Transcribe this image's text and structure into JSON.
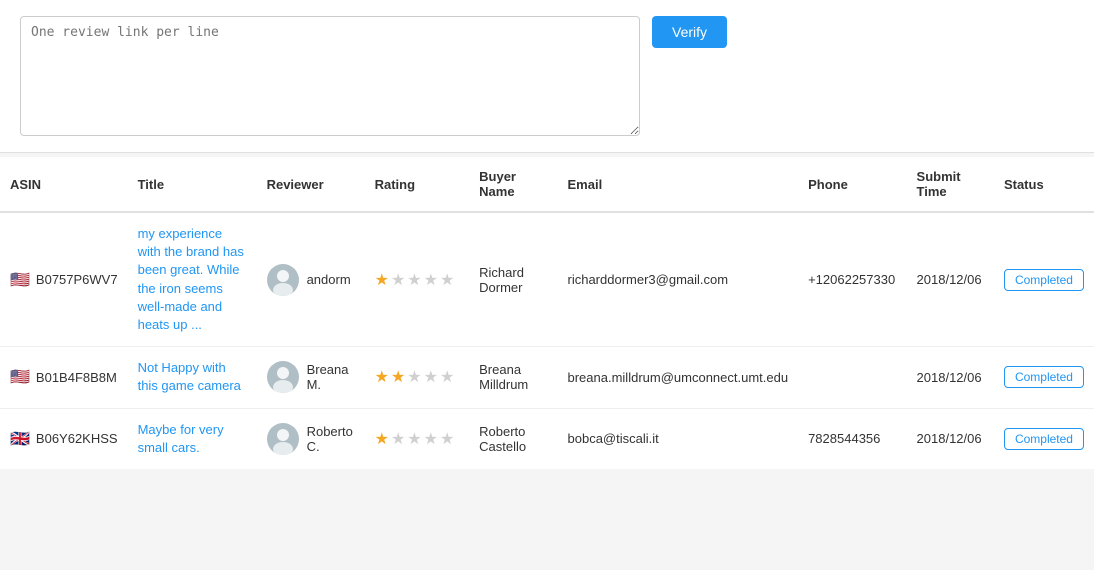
{
  "topSection": {
    "textarea": {
      "placeholder": "One review link per line"
    },
    "verifyButton": "Verify"
  },
  "table": {
    "columns": [
      "ASIN",
      "Title",
      "Reviewer",
      "Rating",
      "Buyer Name",
      "Email",
      "Phone",
      "Submit Time",
      "Status"
    ],
    "rows": [
      {
        "flag": "🇺🇸",
        "asin": "B0757P6WV7",
        "title": "my experience with the brand has been great. While the iron seems well-made and heats up ...",
        "reviewer_avatar": "person",
        "reviewer_name": "andorm",
        "rating": 1,
        "max_rating": 5,
        "buyer_name": "Richard Dormer",
        "email": "richarddormer3@gmail.com",
        "phone": "+12062257330",
        "submit_time": "2018/12/06",
        "status": "Completed"
      },
      {
        "flag": "🇺🇸",
        "asin": "B01B4F8B8M",
        "title": "Not Happy with this game camera",
        "reviewer_avatar": "person",
        "reviewer_name": "Breana M.",
        "rating": 2,
        "max_rating": 5,
        "buyer_name": "Breana Milldrum",
        "email": "breana.milldrum@umconnect.umt.edu",
        "phone": "",
        "submit_time": "2018/12/06",
        "status": "Completed"
      },
      {
        "flag": "🇬🇧",
        "asin": "B06Y62KHSS",
        "title": "Maybe for very small cars.",
        "reviewer_avatar": "person",
        "reviewer_name": "Roberto C.",
        "rating": 1,
        "max_rating": 5,
        "buyer_name": "Roberto Castello",
        "email": "bobca@tiscali.it",
        "phone": "7828544356",
        "submit_time": "2018/12/06",
        "status": "Completed"
      }
    ]
  }
}
